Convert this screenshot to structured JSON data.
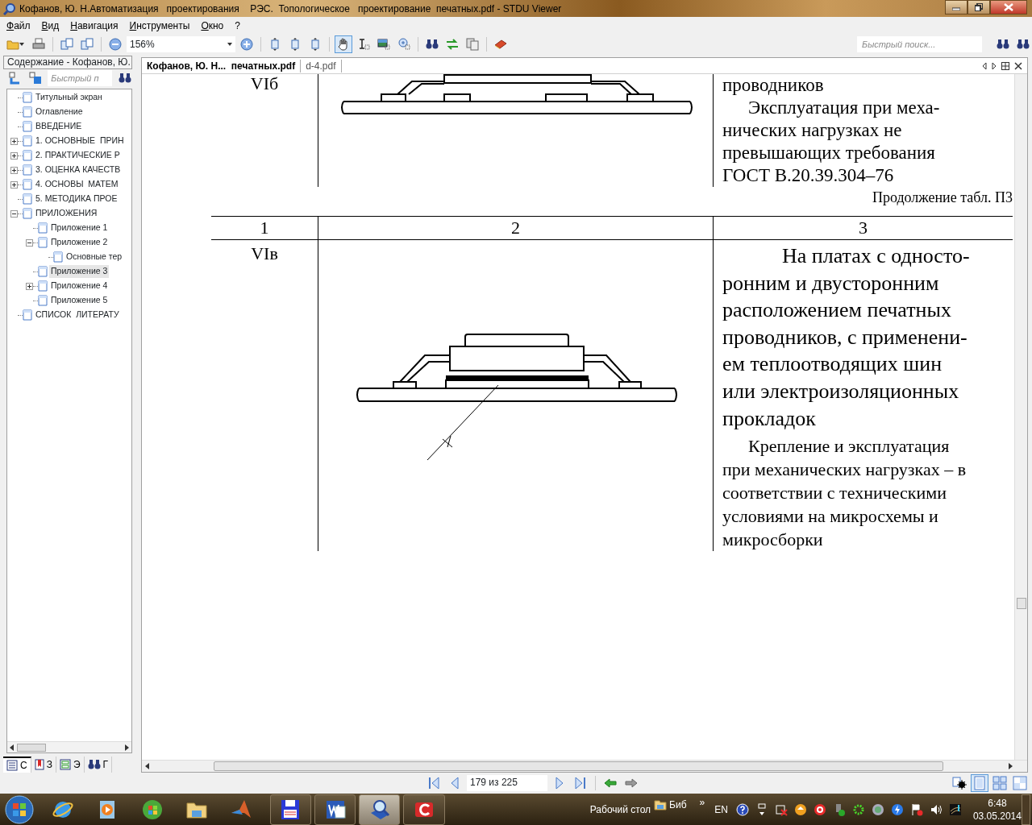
{
  "window": {
    "title": "Кофанов, Ю. Н.Автоматизация   проектирования    РЭС.  Топологическое   проектирование  печатных.pdf - STDU Viewer"
  },
  "menu": [
    {
      "label": "Файл"
    },
    {
      "label": "Вид"
    },
    {
      "label": "Навигация"
    },
    {
      "label": "Инструменты"
    },
    {
      "label": "Окно"
    },
    {
      "label": "?"
    }
  ],
  "toolbar": {
    "zoom": "156%",
    "search_placeholder": "Быстрый поиск...",
    "tools": [
      {
        "kind": "hand",
        "selected": true
      },
      {
        "kind": "text-select",
        "selected": false
      },
      {
        "kind": "image-select",
        "selected": false
      },
      {
        "kind": "zoom-area",
        "selected": false
      }
    ]
  },
  "sidebar": {
    "title": "Содержание - Кофанов, Ю.",
    "search_placeholder": "Быстрый п",
    "tree": [
      {
        "label": "Титульный экран",
        "selected": false
      },
      {
        "label": "Оглавление",
        "selected": false
      },
      {
        "label": "ВВЕДЕНИЕ",
        "selected": false
      },
      {
        "label": "1. ОСНОВНЫЕ  ПРИН",
        "selected": false,
        "expanded": false
      },
      {
        "label": "2. ПРАКТИЧЕСКИЕ Р",
        "selected": false,
        "expanded": false
      },
      {
        "label": "3. ОЦЕНКА КАЧЕСТВ",
        "selected": false,
        "expanded": false
      },
      {
        "label": "4. ОСНОВЫ  МАТЕМ",
        "selected": false,
        "expanded": false
      },
      {
        "label": "5. МЕТОДИКА ПРОЕ",
        "selected": false
      },
      {
        "label": "ПРИЛОЖЕНИЯ",
        "selected": false,
        "expanded": true,
        "children": [
          {
            "label": "Приложение 1",
            "selected": false
          },
          {
            "label": "Приложение 2",
            "selected": false,
            "expanded": true,
            "children": [
              {
                "label": "Основные тер",
                "selected": false
              }
            ]
          },
          {
            "label": "Приложение 3",
            "selected": true
          },
          {
            "label": "Приложение 4",
            "selected": false,
            "expanded": false
          },
          {
            "label": "Приложение 5",
            "selected": false
          }
        ]
      },
      {
        "label": "СПИСОК  ЛИТЕРАТУ",
        "selected": false
      }
    ],
    "tabs": [
      {
        "kind": "contents",
        "label": "С",
        "selected": true
      },
      {
        "kind": "bookmarks",
        "label": "З",
        "selected": false
      },
      {
        "kind": "thumbnails",
        "label": "Э",
        "selected": false
      },
      {
        "kind": "search",
        "label": "Г",
        "selected": false
      }
    ]
  },
  "document": {
    "tabs": [
      {
        "label": "Кофанов, Ю. Н...  печатных.pdf",
        "selected": true
      },
      {
        "label": "d-4.pdf",
        "selected": false
      }
    ],
    "page": {
      "top_row": {
        "column_1": "VIб",
        "column_3_heading": "проводников",
        "column_3_lines": [
          "Эксплуатация при меха-",
          "нических нагрузках не",
          "превышающих требования",
          "ГОСТ В.20.39.304–76"
        ]
      },
      "caption": "Продолжение табл. П3",
      "header": [
        "1",
        "2",
        "3"
      ],
      "row": {
        "column_1": "VIв",
        "paragraphs": [
          [
            "На платах с односто-",
            "ронним и двусторонним",
            "расположением печатных",
            "проводников, с применени-",
            "ем теплоотводящих шин",
            "или электроизоляционных",
            "прокладок"
          ],
          [
            "Крепление и эксплуатация",
            "при механических нагрузках – в",
            "соответствии с техническими",
            "условиями на микросхемы и",
            "микросборки"
          ]
        ]
      }
    }
  },
  "status_bar": {
    "page_indicator": "179 из 225",
    "view_modes": [
      {
        "kind": "single",
        "selected": true
      },
      {
        "kind": "grid",
        "selected": false
      },
      {
        "kind": "facing",
        "selected": false
      }
    ]
  },
  "taskbar": {
    "apps": [
      {
        "kind": "ie",
        "running": false,
        "active": false
      },
      {
        "kind": "media",
        "running": false,
        "active": false
      },
      {
        "kind": "wmp",
        "running": false,
        "active": false
      },
      {
        "kind": "folder",
        "running": false,
        "active": false
      },
      {
        "kind": "matlab",
        "running": false,
        "active": false
      },
      {
        "kind": "floppy",
        "running": true,
        "active": false
      },
      {
        "kind": "word",
        "running": true,
        "active": false
      },
      {
        "kind": "viewer",
        "running": true,
        "active": true
      },
      {
        "kind": "red",
        "running": true,
        "active": false
      }
    ],
    "desktop_label": "Рабочий стол",
    "toolbar_label": "Биб",
    "chevron": "»",
    "language": "EN",
    "time": "6:48",
    "date": "03.05.2014"
  }
}
